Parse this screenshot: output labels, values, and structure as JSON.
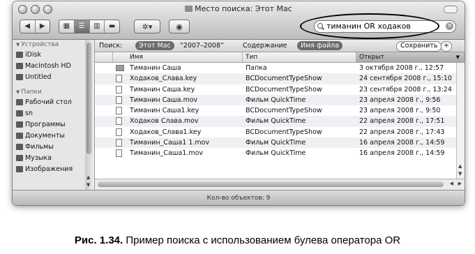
{
  "window": {
    "title": "Место поиска: Этот Mac"
  },
  "toolbar": {
    "nav_back": "◀",
    "nav_forward": "▶",
    "view_modes": [
      "▦",
      "☰",
      "▥",
      "▬"
    ],
    "action_label": "✲▾",
    "quicklook_label": "◉"
  },
  "search": {
    "value": "тиманин OR ходаков",
    "clear": "×"
  },
  "scopebar": {
    "search_label": "Поиск:",
    "scope_active": "Этот Mac",
    "scope_other": "“2007–2008”",
    "content_label": "Содержание",
    "filename_label": "Имя файла",
    "save_label": "Сохранить",
    "add_label": "+"
  },
  "sidebar": {
    "sections": [
      {
        "header": "Устройства",
        "items": [
          {
            "label": "iDisk"
          },
          {
            "label": "Macintosh HD"
          },
          {
            "label": "Untitled"
          }
        ]
      },
      {
        "header": "Папки",
        "items": [
          {
            "label": "Рабочий стол"
          },
          {
            "label": "sn"
          },
          {
            "label": "Программы"
          },
          {
            "label": "Документы"
          },
          {
            "label": "Фильмы"
          },
          {
            "label": "Музыка"
          },
          {
            "label": "Изображения"
          }
        ]
      }
    ]
  },
  "columns": {
    "name": "Имя",
    "kind": "Тип",
    "opened": "Открыт"
  },
  "files": [
    {
      "name": "Тиманин Саша",
      "kind": "Папка",
      "opened": "3 октября 2008 г., 12:57",
      "icon": "folder"
    },
    {
      "name": "Ходаков_Слава.key",
      "kind": "BCDocumentTypeShow",
      "opened": "24 сентября 2008 г., 15:10",
      "icon": "document"
    },
    {
      "name": "Тиманин Саша.key",
      "kind": "BCDocumentTypeShow",
      "opened": "23 сентября 2008 г., 13:24",
      "icon": "document"
    },
    {
      "name": "Тиманин Саша.mov",
      "kind": "Фильм QuickTime",
      "opened": "23 апреля 2008 г., 9:56",
      "icon": "movie"
    },
    {
      "name": "Тиманин Саша1.key",
      "kind": "BCDocumentTypeShow",
      "opened": "23 апреля 2008 г., 9:50",
      "icon": "document"
    },
    {
      "name": "Ходаков Слава.mov",
      "kind": "Фильм QuickTime",
      "opened": "22 апреля 2008 г., 17:51",
      "icon": "movie"
    },
    {
      "name": "Ходаков_Слава1.key",
      "kind": "BCDocumentTypeShow",
      "opened": "22 апреля 2008 г., 17:43",
      "icon": "document"
    },
    {
      "name": "Тиманин_Саша1 1.mov",
      "kind": "Фильм QuickTime",
      "opened": "16 апреля 2008 г., 14:59",
      "icon": "movie"
    },
    {
      "name": "Тиманин_Саша1.mov",
      "kind": "Фильм QuickTime",
      "opened": "16 апреля 2008 г., 14:59",
      "icon": "movie"
    }
  ],
  "status": {
    "text": "Кол-во объектов: 9"
  },
  "caption": {
    "label": "Рис. 1.34.",
    "text": " Пример поиска с использованием булева оператора OR"
  },
  "colors": {
    "scope_pill": "#6b6b6b",
    "sorted_header": "#a9a9a9",
    "annotation_ellipse": "#000000"
  }
}
